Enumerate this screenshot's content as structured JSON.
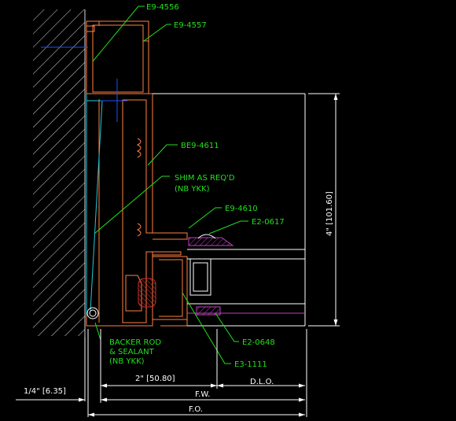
{
  "callouts": {
    "e9_4556": "E9-4556",
    "e9_4557": "E9-4557",
    "be9_4611": "BE9-4611",
    "shim_line1": "SHIM AS REQ'D",
    "shim_line2": "(NB YKK)",
    "e9_4610": "E9-4610",
    "e2_0617": "E2-0617",
    "e2_0648": "E2-0648",
    "e3_1111": "E3-1111",
    "backer_line1": "BACKER ROD",
    "backer_line2": "& SEALANT",
    "backer_line3": "(NB YKK)"
  },
  "dimensions": {
    "frame_depth": "2\" [50.80]",
    "dlo": "D.L.O.",
    "fw": "F.W.",
    "fo": "F.O.",
    "shim_gap": "1/4\" [6.35]",
    "height": "4\" [101.60]"
  },
  "colors": {
    "background": "#000000",
    "frame_outline": "#ff8040",
    "callout_green": "#22e01e",
    "dimension_white": "#ffffff",
    "shim_cyan": "#22c8d8",
    "gasket_purple": "#c040c0",
    "backer_rod_white": "#ffffff",
    "centerline_blue": "#2050ff",
    "sealant_red": "#c02020"
  }
}
